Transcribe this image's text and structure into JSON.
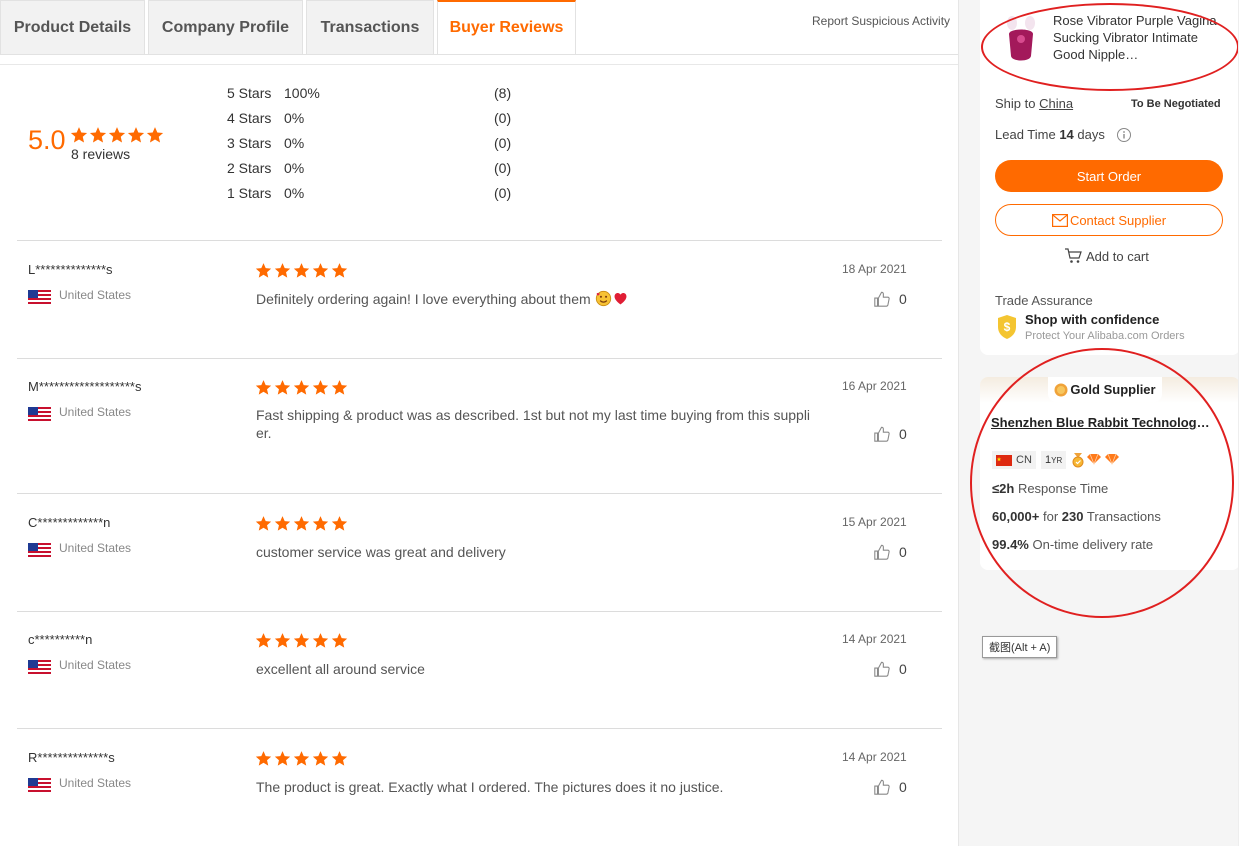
{
  "tabs": [
    {
      "label": "Product Details"
    },
    {
      "label": "Company Profile"
    },
    {
      "label": "Transactions"
    },
    {
      "label": "Buyer Reviews",
      "active": true
    }
  ],
  "report_link": "Report Suspicious Activity",
  "summary": {
    "rating": "5.0",
    "stars": 5,
    "review_count": "8 reviews",
    "distribution": [
      {
        "label": "5  Stars",
        "pct": "100%",
        "count": "(8)"
      },
      {
        "label": "4  Stars",
        "pct": "0%",
        "count": "(0)"
      },
      {
        "label": "3  Stars",
        "pct": "0%",
        "count": "(0)"
      },
      {
        "label": "2  Stars",
        "pct": "0%",
        "count": "(0)"
      },
      {
        "label": "1  Stars",
        "pct": "0%",
        "count": "(0)"
      }
    ]
  },
  "reviews": [
    {
      "name": "L**************s",
      "country": "United States",
      "stars": 5,
      "text": "Definitely ordering again! I love everything about them",
      "date": "18 Apr 2021",
      "likes": "0"
    },
    {
      "name": "M*******************s",
      "country": "United States",
      "stars": 5,
      "text": "Fast shipping & product was as described. 1st but not my last time buying from this supplier.",
      "date": "16 Apr 2021",
      "likes": "0"
    },
    {
      "name": "C*************n",
      "country": "United States",
      "stars": 5,
      "text": "customer service was great and delivery",
      "date": "15 Apr 2021",
      "likes": "0"
    },
    {
      "name": "c**********n",
      "country": "United States",
      "stars": 5,
      "text": "excellent all around service",
      "date": "14 Apr 2021",
      "likes": "0"
    },
    {
      "name": "R**************s",
      "country": "United States",
      "stars": 5,
      "text": "The product is great. Exactly what I ordered. The pictures does it no justice.",
      "date": "14 Apr 2021",
      "likes": "0"
    }
  ],
  "order": {
    "product_title": "Rose Vibrator Purple Vagina Sucking Vibrator Intimate Good Nipple…",
    "ship_to_label": "Ship to",
    "ship_to_country": "China",
    "shipping_value": "To Be Negotiated",
    "lead_time_label": "Lead Time",
    "lead_time_value": "14",
    "lead_time_unit": "days",
    "start_order": "Start Order",
    "contact_supplier": "Contact Supplier",
    "add_to_cart": "Add to cart",
    "trade_assurance": "Trade Assurance",
    "trade_title": "Shop with confidence",
    "trade_sub": "Protect Your Alibaba.com Orders"
  },
  "supplier": {
    "badge": "Gold Supplier",
    "name": "Shenzhen Blue Rabbit Technology Co., Ltd.",
    "country_code": "CN",
    "years": "1",
    "years_unit": "YR",
    "response_value": "≤2h",
    "response_label": "Response Time",
    "transactions_value": "60,000+",
    "transactions_mid": "for",
    "transactions_count": "230",
    "transactions_label": "Transactions",
    "delivery_value": "99.4%",
    "delivery_label": "On-time delivery rate"
  },
  "tooltip": "截图(Alt + A)",
  "colors": {
    "accent": "#ff6a00",
    "annotation": "#e02020"
  }
}
